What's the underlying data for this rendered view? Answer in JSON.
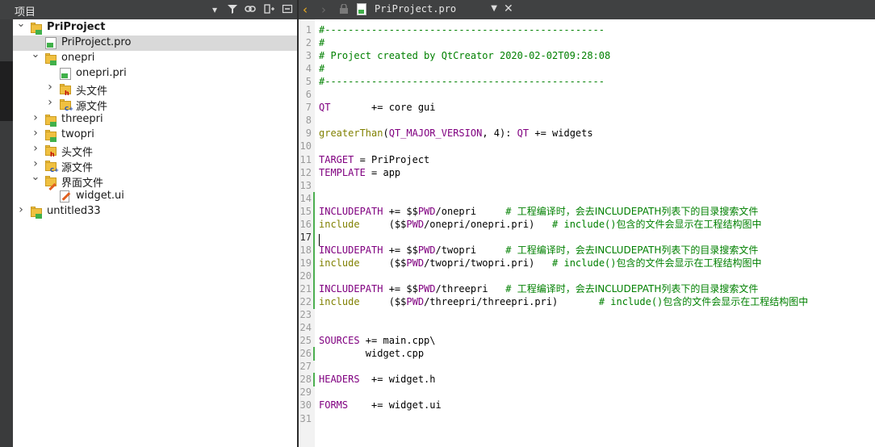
{
  "projects_pane": {
    "title": "项目",
    "tree": [
      {
        "label": "PriProject",
        "level": 0,
        "expanded": true,
        "icon": "qt-project-folder-icon",
        "bold": true
      },
      {
        "label": "PriProject.pro",
        "level": 1,
        "icon": "qt-pro-file-icon",
        "selected": true
      },
      {
        "label": "onepri",
        "level": 1,
        "expanded": true,
        "icon": "qt-folder-icon"
      },
      {
        "label": "onepri.pri",
        "level": 2,
        "icon": "qt-pri-file-icon"
      },
      {
        "label": "头文件",
        "level": 2,
        "expanded": false,
        "icon": "header-folder-icon"
      },
      {
        "label": "源文件",
        "level": 2,
        "expanded": false,
        "icon": "source-folder-icon"
      },
      {
        "label": "threepri",
        "level": 1,
        "expanded": false,
        "icon": "qt-folder-icon"
      },
      {
        "label": "twopri",
        "level": 1,
        "expanded": false,
        "icon": "qt-folder-icon"
      },
      {
        "label": "头文件",
        "level": 1,
        "expanded": false,
        "icon": "header-folder-icon"
      },
      {
        "label": "源文件",
        "level": 1,
        "expanded": false,
        "icon": "source-folder-icon"
      },
      {
        "label": "界面文件",
        "level": 1,
        "expanded": true,
        "icon": "forms-folder-icon"
      },
      {
        "label": "widget.ui",
        "level": 2,
        "icon": "ui-file-icon"
      },
      {
        "label": "untitled33",
        "level": 0,
        "expanded": false,
        "icon": "qt-project-folder-icon"
      }
    ]
  },
  "editor": {
    "file_name": "PriProject.pro",
    "current_line": 17,
    "lines": [
      [
        [
          "cmt",
          "#------------------------------------------------"
        ]
      ],
      [
        [
          "cmt",
          "#"
        ]
      ],
      [
        [
          "cmt",
          "# Project created by QtCreator 2020-02-02T09:28:08"
        ]
      ],
      [
        [
          "cmt",
          "#"
        ]
      ],
      [
        [
          "cmt",
          "#------------------------------------------------"
        ]
      ],
      [],
      [
        [
          "kw",
          "QT"
        ],
        [
          "txt",
          "       += core gui"
        ]
      ],
      [],
      [
        [
          "fn",
          "greaterThan"
        ],
        [
          "txt",
          "("
        ],
        [
          "kw",
          "QT_MAJOR_VERSION"
        ],
        [
          "txt",
          ", 4): "
        ],
        [
          "kw",
          "QT"
        ],
        [
          "txt",
          " += widgets"
        ]
      ],
      [],
      [
        [
          "kw",
          "TARGET"
        ],
        [
          "txt",
          " = PriProject"
        ]
      ],
      [
        [
          "kw",
          "TEMPLATE"
        ],
        [
          "txt",
          " = app"
        ]
      ],
      [],
      [],
      [
        [
          "kw",
          "INCLUDEPATH"
        ],
        [
          "txt",
          " += $$"
        ],
        [
          "var",
          "PWD"
        ],
        [
          "txt",
          "/onepri     "
        ],
        [
          "cmt",
          "# "
        ],
        [
          "cn",
          "工程编译时，会去INCLUDEPATH列表下的目录搜索文件"
        ]
      ],
      [
        [
          "fn",
          "include"
        ],
        [
          "txt",
          "     ($$"
        ],
        [
          "var",
          "PWD"
        ],
        [
          "txt",
          "/onepri/onepri.pri)   "
        ],
        [
          "cmt",
          "# include()"
        ],
        [
          "cn",
          "包含的文件会显示在工程结构图中"
        ]
      ],
      [],
      [
        [
          "kw",
          "INCLUDEPATH"
        ],
        [
          "txt",
          " += $$"
        ],
        [
          "var",
          "PWD"
        ],
        [
          "txt",
          "/twopri     "
        ],
        [
          "cmt",
          "# "
        ],
        [
          "cn",
          "工程编译时，会去INCLUDEPATH列表下的目录搜索文件"
        ]
      ],
      [
        [
          "fn",
          "include"
        ],
        [
          "txt",
          "     ($$"
        ],
        [
          "var",
          "PWD"
        ],
        [
          "txt",
          "/twopri/twopri.pri)   "
        ],
        [
          "cmt",
          "# include()"
        ],
        [
          "cn",
          "包含的文件会显示在工程结构图中"
        ]
      ],
      [],
      [
        [
          "kw",
          "INCLUDEPATH"
        ],
        [
          "txt",
          " += $$"
        ],
        [
          "var",
          "PWD"
        ],
        [
          "txt",
          "/threepri   "
        ],
        [
          "cmt",
          "# "
        ],
        [
          "cn",
          "工程编译时，会去INCLUDEPATH列表下的目录搜索文件"
        ]
      ],
      [
        [
          "fn",
          "include"
        ],
        [
          "txt",
          "     ($$"
        ],
        [
          "var",
          "PWD"
        ],
        [
          "txt",
          "/threepri/threepri.pri)       "
        ],
        [
          "cmt",
          "# include()"
        ],
        [
          "cn",
          "包含的文件会显示在工程结构图中"
        ]
      ],
      [],
      [],
      [
        [
          "kw",
          "SOURCES"
        ],
        [
          "txt",
          " += main.cpp\\"
        ]
      ],
      [
        [
          "txt",
          "        widget.cpp"
        ]
      ],
      [],
      [
        [
          "kw",
          "HEADERS"
        ],
        [
          "txt",
          "  += widget.h"
        ]
      ],
      [],
      [
        [
          "kw",
          "FORMS"
        ],
        [
          "txt",
          "    += widget.ui"
        ]
      ],
      []
    ]
  }
}
